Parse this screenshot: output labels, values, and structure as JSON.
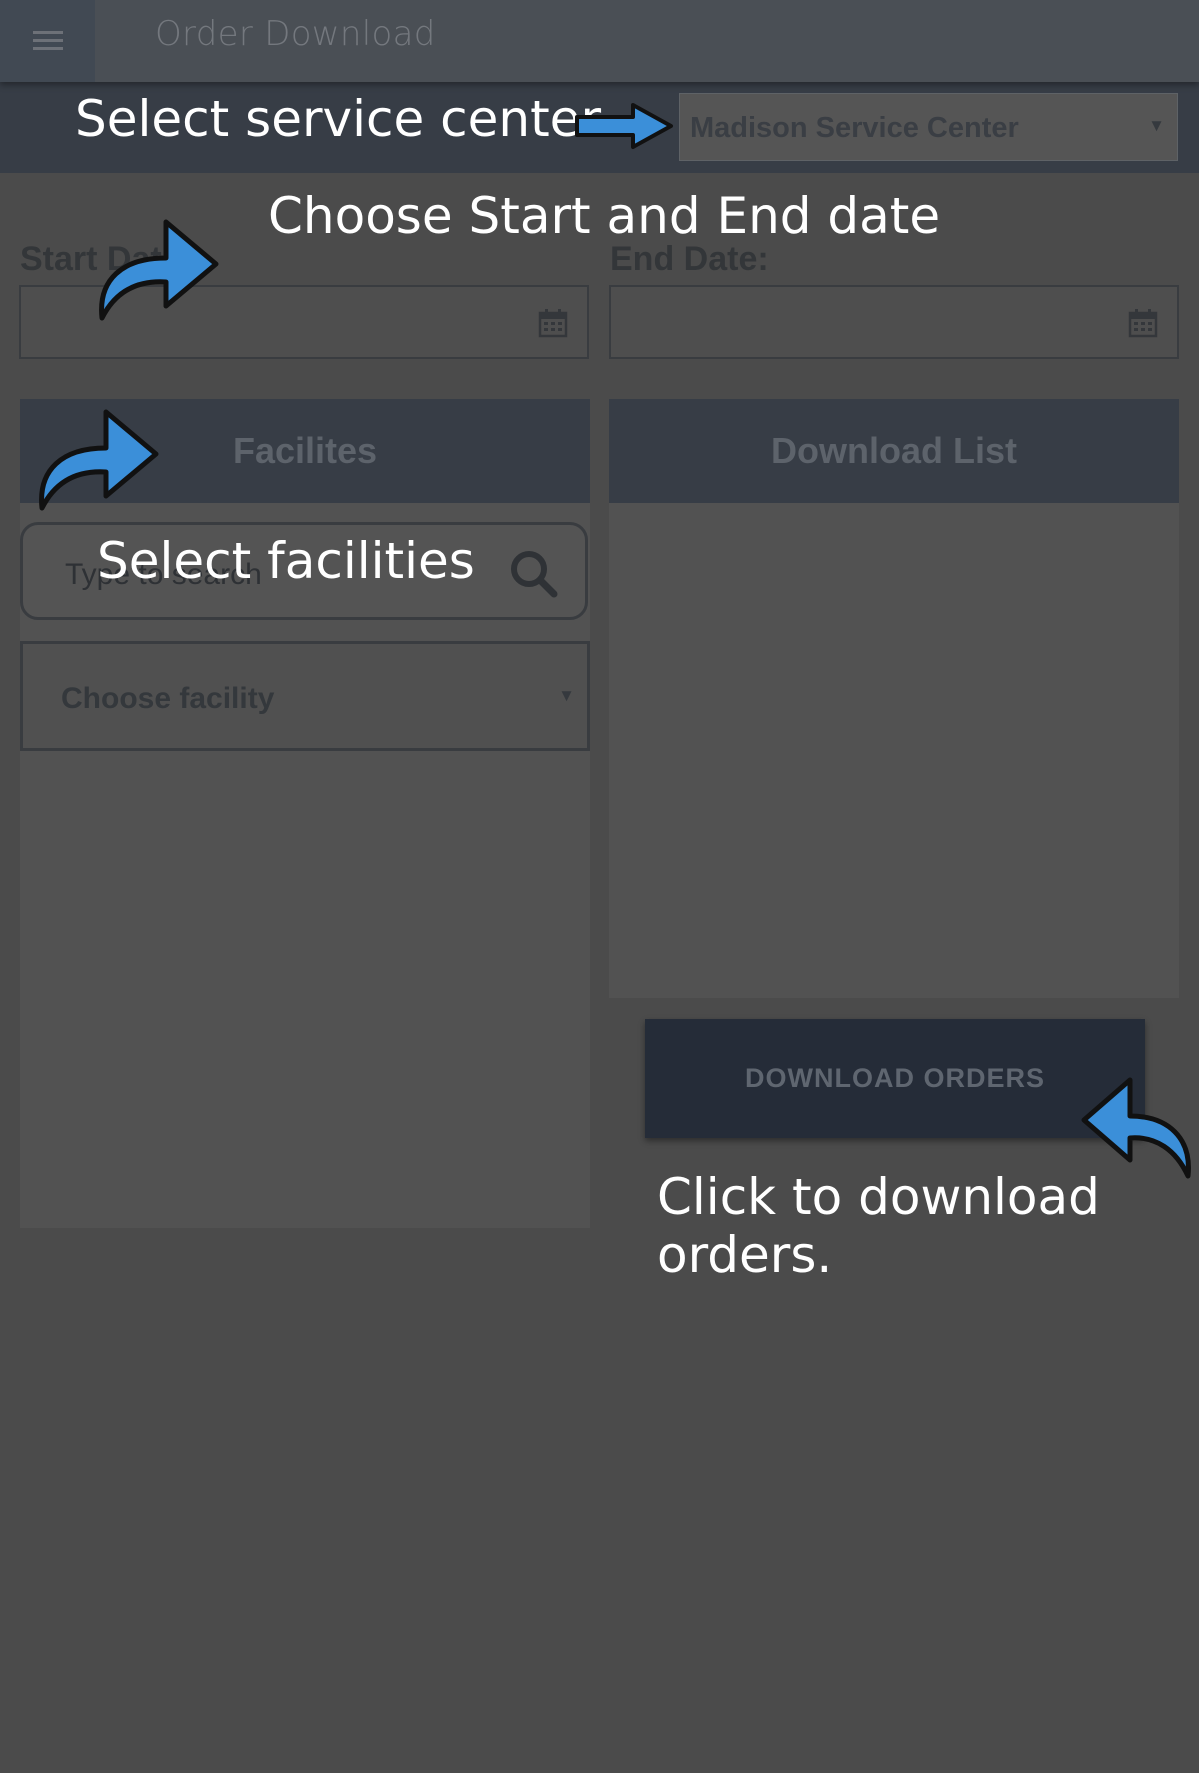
{
  "header": {
    "menu_icon": "hamburger-menu-icon",
    "title": "Order Download"
  },
  "service_center": {
    "selected": "Madison Service Center"
  },
  "dates": {
    "start_label": "Start Date:",
    "end_label": "End Date:",
    "start_value": "",
    "end_value": "",
    "calendar_icon": "calendar-icon"
  },
  "facilities": {
    "header": "Facilites",
    "search_placeholder": "Type to search",
    "search_icon": "search-icon",
    "select_value": "Choose facility"
  },
  "download_list": {
    "header": "Download List"
  },
  "actions": {
    "download_orders": "DOWNLOAD ORDERS"
  },
  "annotations": {
    "service_center": "Select service center",
    "dates": "Choose Start and End date",
    "facilities": "Select facilities",
    "download_line1": "Click to download",
    "download_line2": "orders."
  },
  "colors": {
    "overlay_background": "#4b4b4b",
    "dark_header": "#373d46",
    "button": "#252c38",
    "arrow_blue": "#3b8fd9",
    "annotation_text": "#ffffff"
  }
}
